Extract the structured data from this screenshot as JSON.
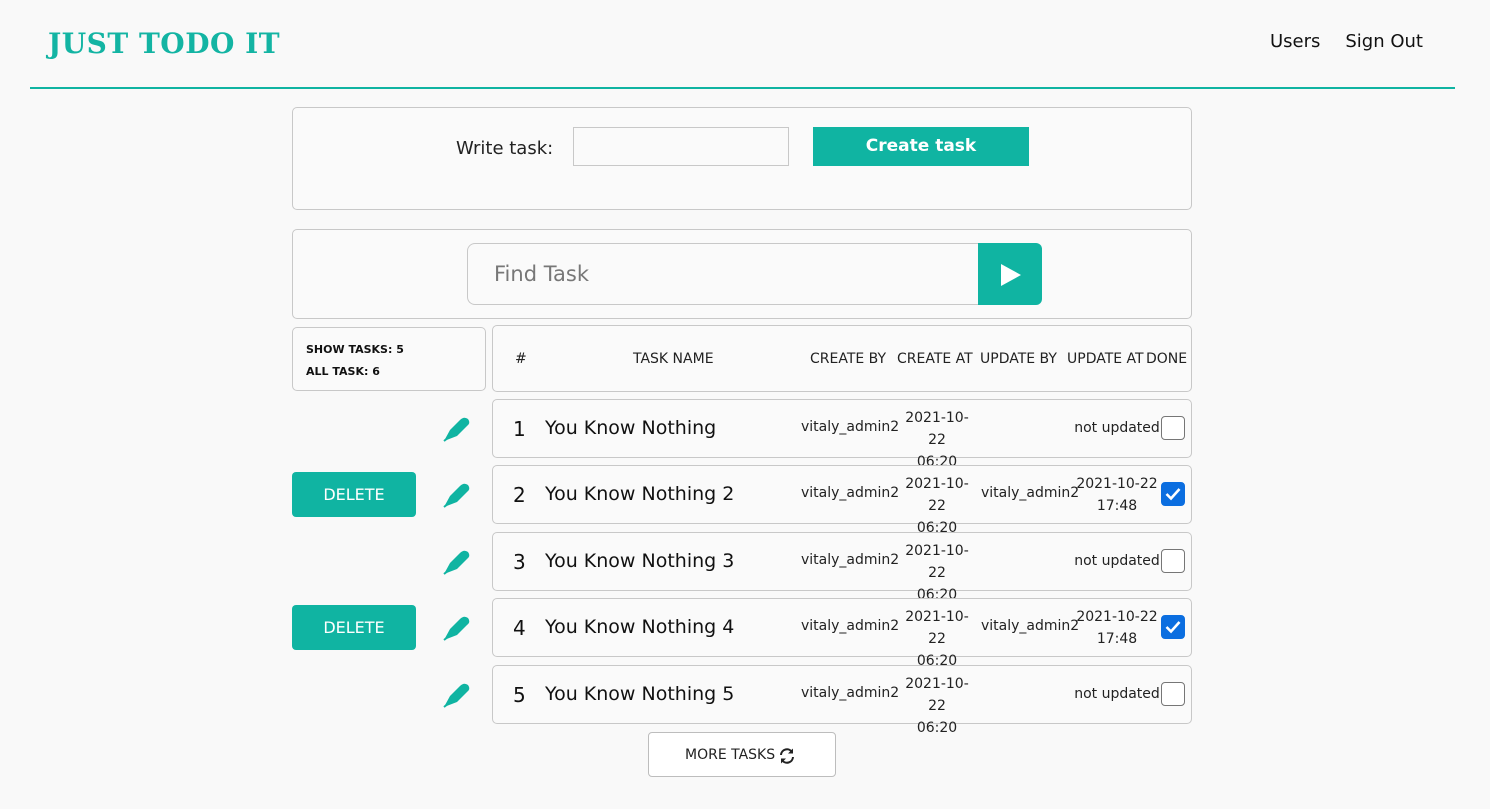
{
  "header": {
    "logo": "JUST TODO IT",
    "nav": [
      "Users",
      "Sign Out"
    ]
  },
  "create": {
    "label": "Write task:",
    "input_value": "",
    "button_label": "Create task"
  },
  "search": {
    "placeholder": "Find Task",
    "icon": "play-icon"
  },
  "stats": {
    "show_tasks": "SHOW TASKS: 5",
    "all_tasks": "ALL TASK: 6"
  },
  "table": {
    "columns": [
      "#",
      "TASK NAME",
      "CREATE BY",
      "CREATE AT",
      "UPDATE BY",
      "UPDATE AT",
      "DONE"
    ],
    "rows": [
      {
        "num": "1",
        "name": "You Know Nothing",
        "created_by": "vitaly_admin2",
        "created_date": "2021-10-22",
        "created_time": "06:20",
        "updated_by": "",
        "updated_date": "not updated",
        "updated_time": "",
        "done": false,
        "has_delete": false
      },
      {
        "num": "2",
        "name": "You Know Nothing 2",
        "created_by": "vitaly_admin2",
        "created_date": "2021-10-22",
        "created_time": "06:20",
        "updated_by": "vitaly_admin2",
        "updated_date": "2021-10-22",
        "updated_time": "17:48",
        "done": true,
        "has_delete": true
      },
      {
        "num": "3",
        "name": "You Know Nothing 3",
        "created_by": "vitaly_admin2",
        "created_date": "2021-10-22",
        "created_time": "06:20",
        "updated_by": "",
        "updated_date": "not updated",
        "updated_time": "",
        "done": false,
        "has_delete": false
      },
      {
        "num": "4",
        "name": "You Know Nothing 4",
        "created_by": "vitaly_admin2",
        "created_date": "2021-10-22",
        "created_time": "06:20",
        "updated_by": "vitaly_admin2",
        "updated_date": "2021-10-22",
        "updated_time": "17:48",
        "done": true,
        "has_delete": true
      },
      {
        "num": "5",
        "name": "You Know Nothing 5",
        "created_by": "vitaly_admin2",
        "created_date": "2021-10-22",
        "created_time": "06:20",
        "updated_by": "",
        "updated_date": "not updated",
        "updated_time": "",
        "done": false,
        "has_delete": false
      }
    ],
    "delete_label": "DELETE",
    "edit_icon": "pen-icon"
  },
  "more": {
    "label": "MORE TASKS",
    "icon": "refresh-icon"
  },
  "colors": {
    "accent": "#10b4a2",
    "checkbox": "#0b6ee0"
  }
}
